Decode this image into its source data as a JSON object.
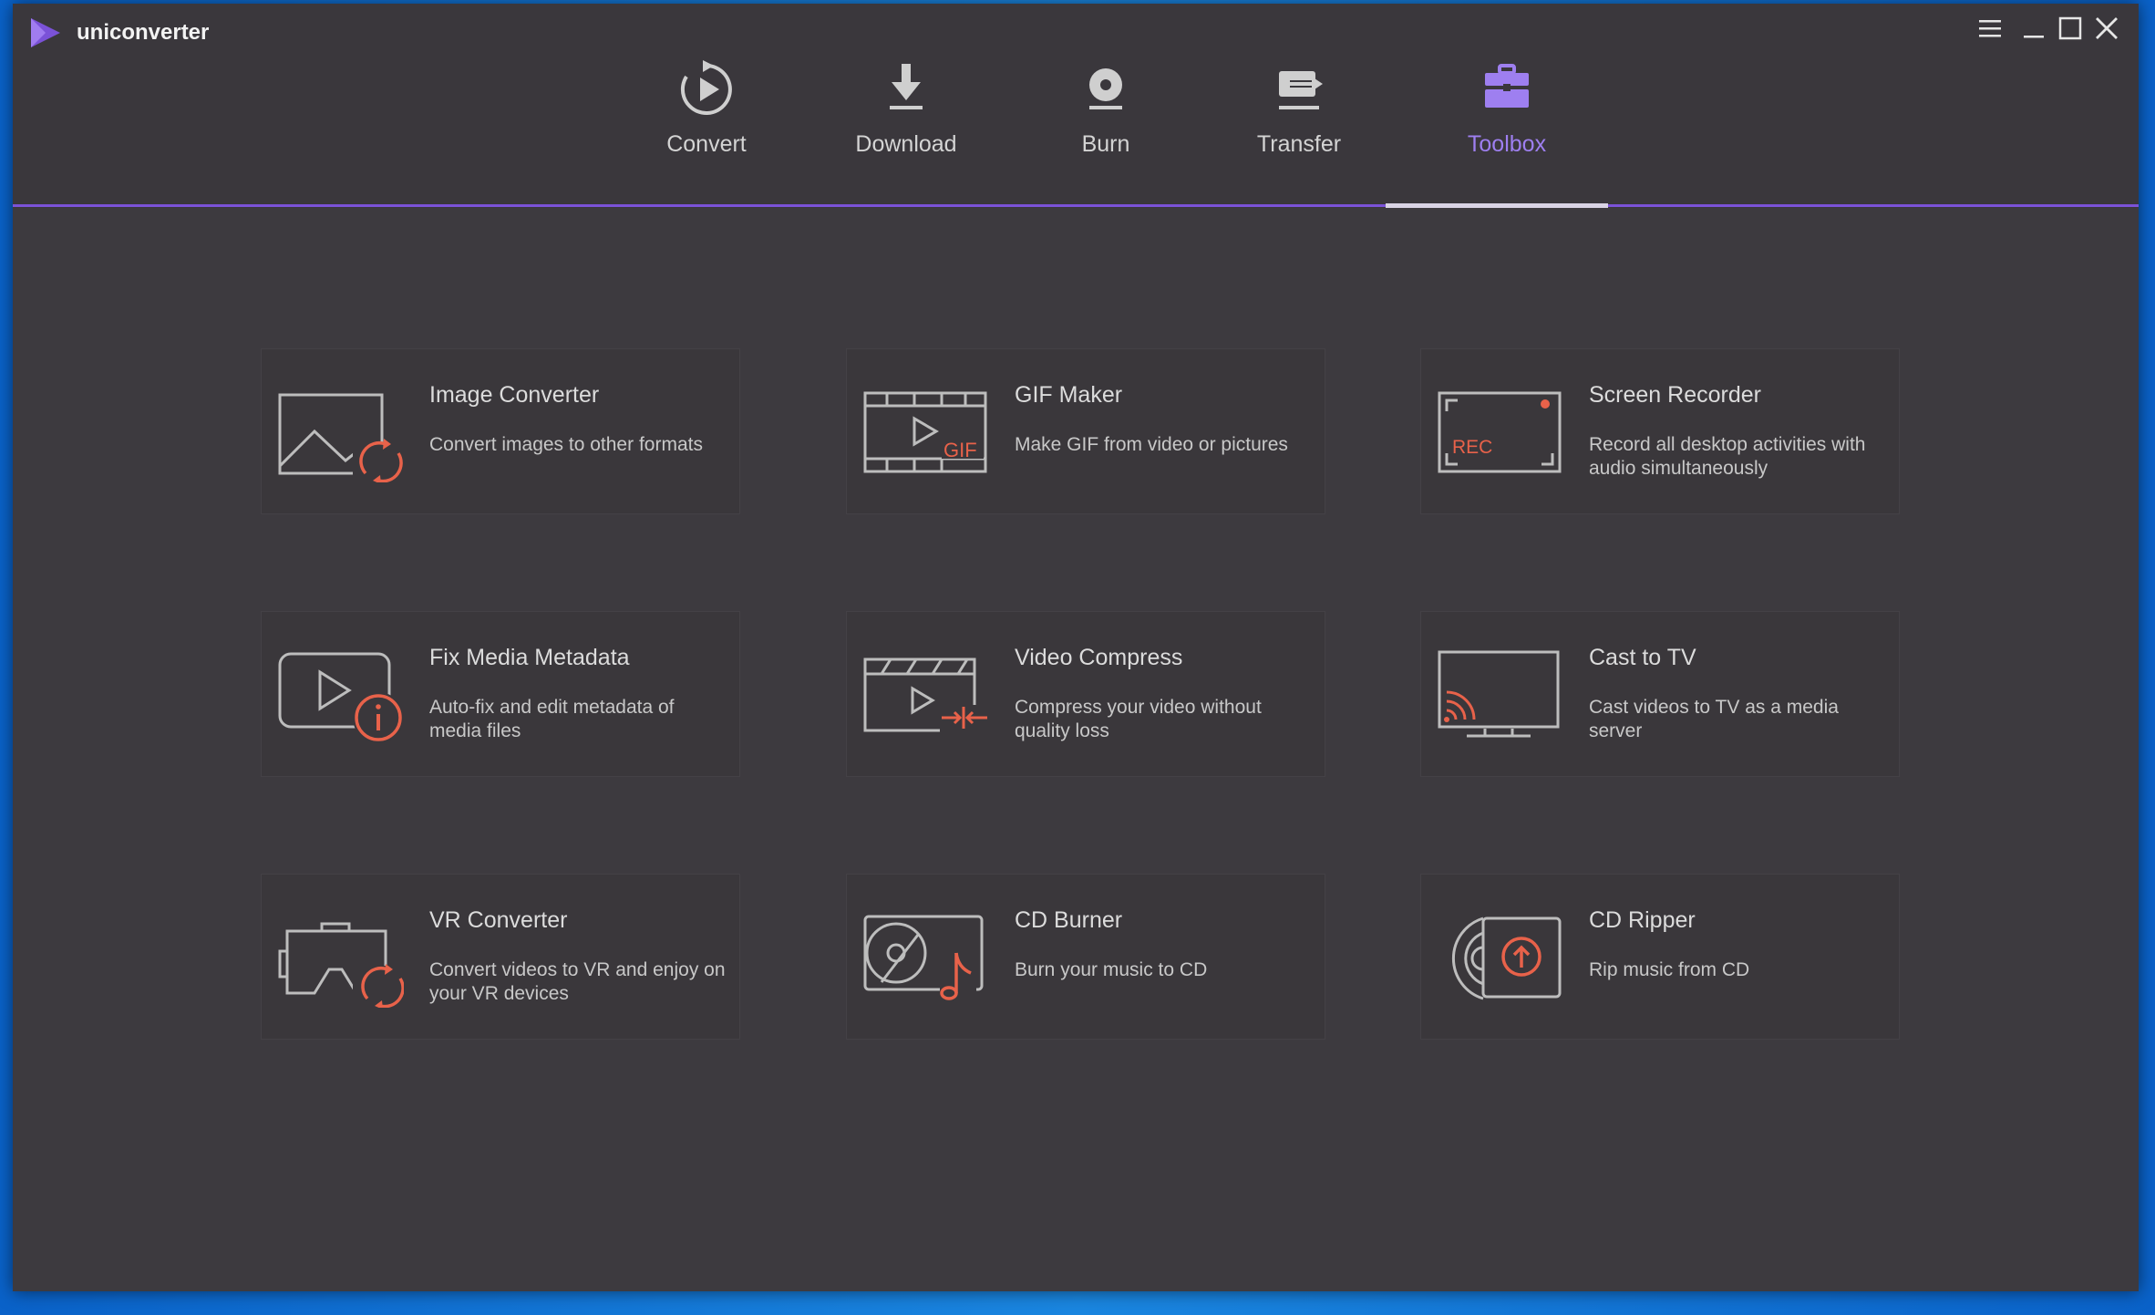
{
  "app": {
    "title": "uniconverter"
  },
  "colors": {
    "accent": "#9e7ff0",
    "tab_line": "#7b52d8",
    "icon_orange": "#e8624a",
    "icon_gray": "#bdbdbd",
    "background": "#3d3a3f",
    "card": "#3a373b"
  },
  "window_controls": [
    {
      "icon": "menu-icon"
    },
    {
      "icon": "minimize-icon"
    },
    {
      "icon": "maximize-icon"
    },
    {
      "icon": "close-icon"
    }
  ],
  "tabs": [
    {
      "label": "Convert",
      "icon": "convert-icon",
      "active": false
    },
    {
      "label": "Download",
      "icon": "download-icon",
      "active": false
    },
    {
      "label": "Burn",
      "icon": "burn-icon",
      "active": false
    },
    {
      "label": "Transfer",
      "icon": "transfer-icon",
      "active": false
    },
    {
      "label": "Toolbox",
      "icon": "toolbox-icon",
      "active": true
    }
  ],
  "tools": [
    {
      "title": "Image Converter",
      "description": "Convert images to other formats",
      "icon": "image-converter-icon"
    },
    {
      "title": "GIF Maker",
      "description": "Make GIF from video or pictures",
      "icon": "gif-maker-icon",
      "icon_text": "GIF"
    },
    {
      "title": "Screen Recorder",
      "description": "Record all desktop activities with audio simultaneously",
      "icon": "screen-recorder-icon",
      "icon_text": "REC"
    },
    {
      "title": "Fix Media Metadata",
      "description": "Auto-fix and edit metadata of media files",
      "icon": "fix-metadata-icon"
    },
    {
      "title": "Video Compress",
      "description": "Compress your video without quality loss",
      "icon": "video-compress-icon"
    },
    {
      "title": "Cast to TV",
      "description": "Cast videos to TV as a media server",
      "icon": "cast-to-tv-icon"
    },
    {
      "title": "VR Converter",
      "description": "Convert videos to VR and enjoy on your VR devices",
      "icon": "vr-converter-icon"
    },
    {
      "title": "CD Burner",
      "description": "Burn your music to CD",
      "icon": "cd-burner-icon"
    },
    {
      "title": "CD Ripper",
      "description": "Rip music from CD",
      "icon": "cd-ripper-icon"
    }
  ]
}
